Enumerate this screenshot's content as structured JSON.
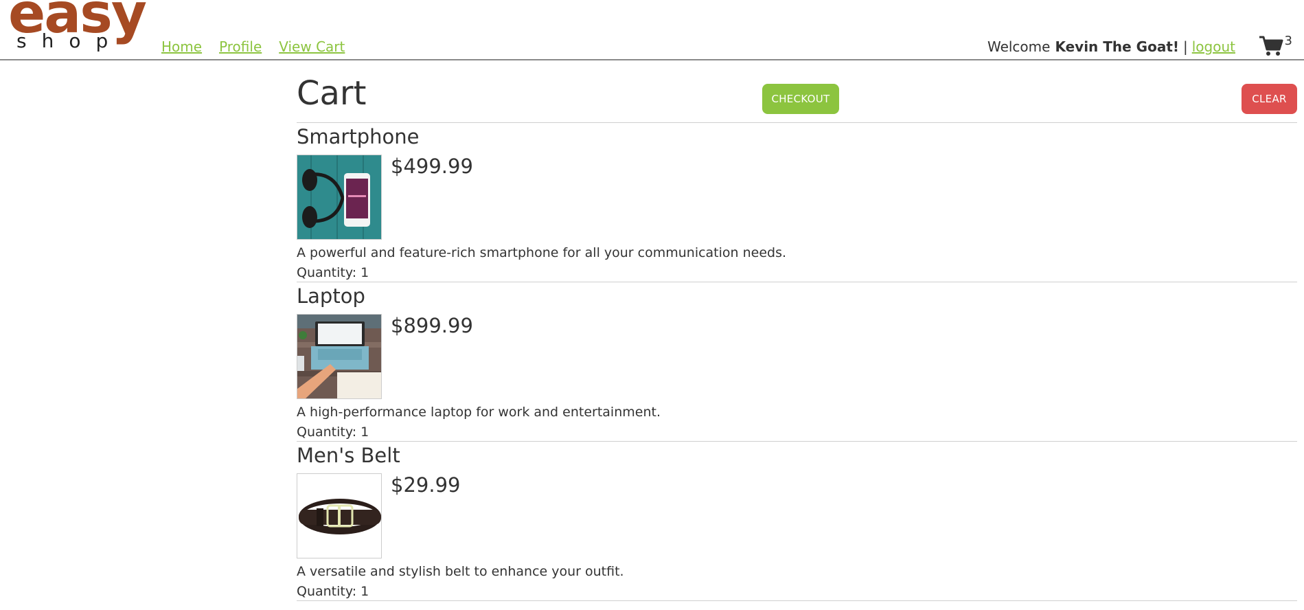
{
  "brand": {
    "top": "easy",
    "bottom": "shop"
  },
  "nav": [
    {
      "label": "Home"
    },
    {
      "label": "Profile"
    },
    {
      "label": "View Cart"
    }
  ],
  "user": {
    "welcome": "Welcome",
    "name": "Kevin The Goat!",
    "separator": "|",
    "logout": "logout",
    "cart_count": "3",
    "cart_icon": "shopping-cart-icon"
  },
  "cart": {
    "title": "Cart",
    "checkout_label": "CHECKOUT",
    "clear_label": "CLEAR",
    "quantity_label": "Quantity:",
    "items": [
      {
        "name": "Smartphone",
        "price": "$499.99",
        "description": "A powerful and feature-rich smartphone for all your communication needs.",
        "quantity": "1"
      },
      {
        "name": "Laptop",
        "price": "$899.99",
        "description": "A high-performance laptop for work and entertainment.",
        "quantity": "1"
      },
      {
        "name": "Men's Belt",
        "price": "$29.99",
        "description": "A versatile and stylish belt to enhance your outfit.",
        "quantity": "1"
      }
    ]
  },
  "colors": {
    "brand": "#a64a23",
    "link": "#8cc43f",
    "checkout": "#8cc43f",
    "clear": "#de4f4f"
  }
}
